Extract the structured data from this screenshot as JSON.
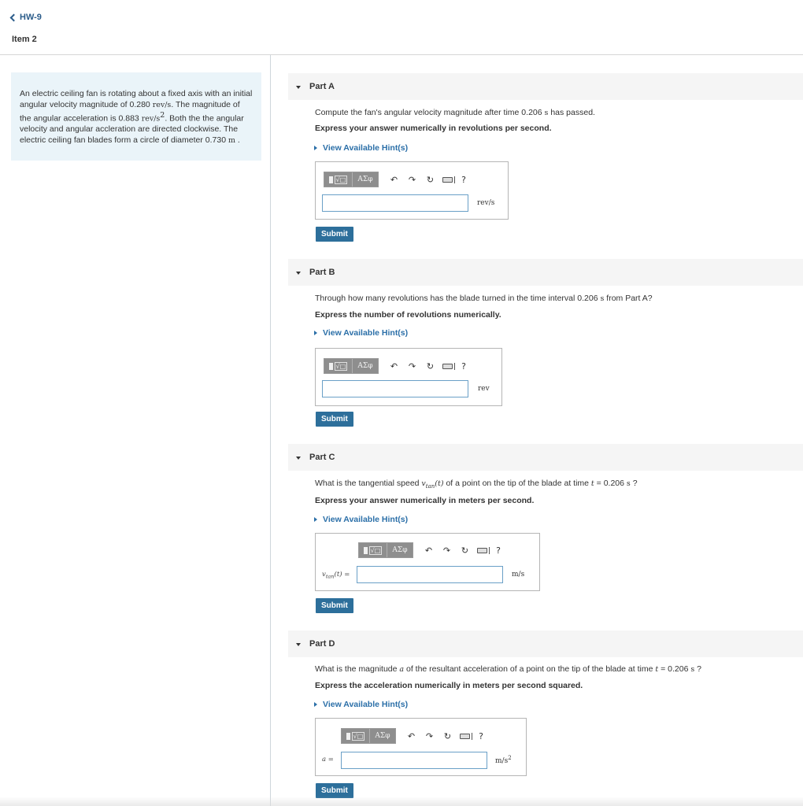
{
  "nav": {
    "back_label": "HW-9",
    "item_title": "Item 2"
  },
  "problem": {
    "t1": "An electric ceiling fan is rotating about a fixed axis with an initial angular velocity magnitude of 0.280 ",
    "u1": "rev/s",
    "t2": ". The magnitude of the angular acceleration is 0.883 ",
    "u2": "rev/s",
    "u2_exp": "2",
    "t3": ". Both the the angular velocity and angular accleration are directed clockwise. The electric ceiling fan blades form a circle of diameter 0.730 ",
    "u3": "m",
    "t4": " ."
  },
  "toolbar": {
    "templates_label": "√□",
    "greek_label": "ΑΣφ",
    "undo_icon": "undo-icon",
    "redo_icon": "redo-icon",
    "reset_icon": "reset-icon",
    "keyboard_icon": "keyboard-icon",
    "help_label": "?"
  },
  "common": {
    "hint_label": "View Available Hint(s)",
    "submit_label": "Submit"
  },
  "parts": [
    {
      "label": "Part A",
      "q_pre": "Compute the fan's angular velocity magnitude after time 0.206 ",
      "q_unit": "s",
      "q_post": " has passed.",
      "instruction": "Express your answer numerically in revolutions per second.",
      "unit": "rev/s",
      "input_value": ""
    },
    {
      "label": "Part B",
      "q_pre": "Through how many revolutions has the blade turned in the time interval 0.206 ",
      "q_unit": "s",
      "q_post": " from Part A?",
      "instruction": "Express the number of revolutions numerically.",
      "unit": "rev",
      "input_value": ""
    },
    {
      "label": "Part C",
      "q_pre": "What is the tangential speed ",
      "q_var": "v",
      "q_sub": "tan",
      "q_arg": "(t)",
      "q_mid": " of a point on the tip of the blade at time ",
      "q_t": "t",
      "q_eq": " = 0.206 ",
      "q_unit": "s",
      "q_post": " ?",
      "instruction": "Express your answer numerically in meters per second.",
      "lhs_var": "v",
      "lhs_sub": "tan",
      "lhs_arg": "(t) =",
      "unit": "m/s",
      "input_value": ""
    },
    {
      "label": "Part D",
      "q_pre": "What is the magnitude ",
      "q_var": "a",
      "q_mid": " of the resultant acceleration of a point on the tip of the blade at time ",
      "q_t": "t",
      "q_eq": " = 0.206 ",
      "q_unit": "s",
      "q_post": " ?",
      "instruction": "Express the acceleration numerically in meters per second squared.",
      "lhs_var": "a",
      "lhs_eq": " =",
      "unit": "m/s",
      "unit_exp": "2",
      "input_value": ""
    }
  ]
}
